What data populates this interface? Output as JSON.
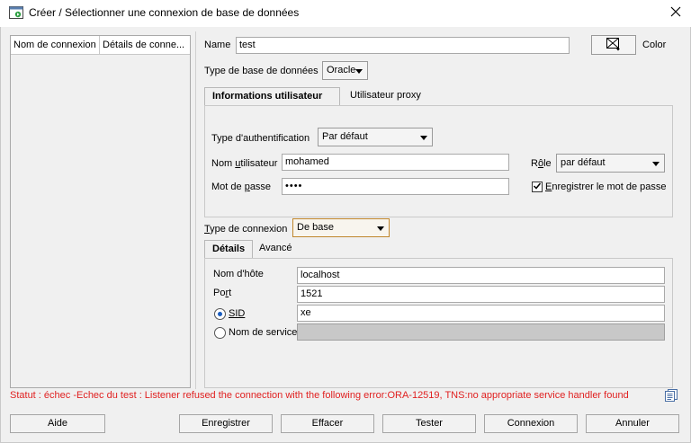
{
  "window": {
    "title": "Créer / Sélectionner une connexion de base de données"
  },
  "connection_list": {
    "columns": [
      "Nom de connexion",
      "Détails de conne..."
    ]
  },
  "form": {
    "name_label": "Name",
    "name_value": "test",
    "color_label": "Color",
    "db_type_label": "Type de base de données",
    "db_type_value": "Oracle"
  },
  "user_tabs": [
    "Informations utilisateur",
    "Utilisateur proxy"
  ],
  "user_info": {
    "auth_label": "Type d'authentification",
    "auth_value": "Par défaut",
    "username_label_pre": "Nom ",
    "username_label_ul": "u",
    "username_label_post": "tilisateur",
    "username_value": "mohamed",
    "role_label_pre": "R",
    "role_label_ul": "ô",
    "role_label_post": "le",
    "role_value": "par défaut",
    "password_label_pre": "Mot de ",
    "password_label_ul": "p",
    "password_label_post": "asse",
    "password_value": "••••",
    "save_password_label_pre": "",
    "save_password_label_ul": "E",
    "save_password_label_post": "nregistrer le mot de passe",
    "save_password_checked": true
  },
  "connection_type": {
    "label_pre": "",
    "label_ul": "T",
    "label_post": "ype de connexion",
    "value": "De base"
  },
  "detail_tabs": [
    "Détails",
    "Avancé"
  ],
  "details": {
    "host_label": "Nom d'hôte",
    "host_value": "localhost",
    "port_label_pre": "Po",
    "port_label_ul": "r",
    "port_label_post": "t",
    "port_value": "1521",
    "sid_label": "SID",
    "sid_value": "xe",
    "service_label": "Nom de service",
    "service_value": ""
  },
  "status": "Statut : échec -Echec du test : Listener refused the connection with the following error:ORA-12519, TNS:no appropriate service handler found",
  "buttons": {
    "help": "Aide",
    "save": "Enregistrer",
    "clear": "Effacer",
    "test": "Tester",
    "connect": "Connexion",
    "cancel": "Annuler"
  },
  "colors": {
    "status_error": "#e02020",
    "focus_border": "#c0862c",
    "radio_dot": "#1a5dbf"
  }
}
